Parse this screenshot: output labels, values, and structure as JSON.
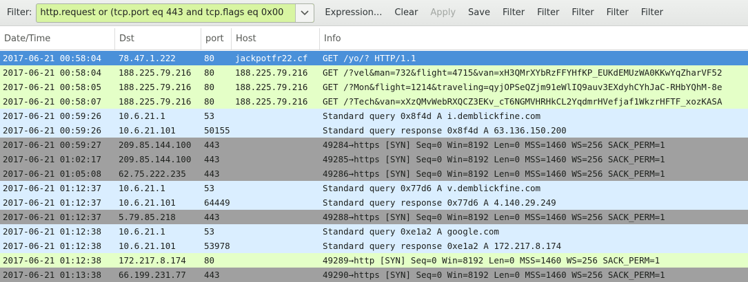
{
  "toolbar": {
    "filter_label": "Filter:",
    "filter_value": "http.request or (tcp.port eq 443 and tcp.flags eq 0x00",
    "filter_bg": "#d8f5a2",
    "expression_label": "Expression...",
    "clear_label": "Clear",
    "apply_label": "Apply",
    "save_label": "Save",
    "filter_buttons": [
      "Filter",
      "Filter",
      "Filter",
      "Filter",
      "Filter"
    ]
  },
  "columns": [
    "Date/Time",
    "Dst",
    "port",
    "Host",
    "Info"
  ],
  "colors": {
    "selected": "#4a90d9",
    "http": "#e4ffc7",
    "udp": "#daeeff",
    "tcp_syn": "#a0a0a0"
  },
  "rows": [
    {
      "datetime": "2017-06-21 00:58:04",
      "dst": "78.47.1.222",
      "port": "80",
      "host": "jackpotfr22.cf",
      "info": "GET /yo/? HTTP/1.1",
      "style": "selected"
    },
    {
      "datetime": "2017-06-21 00:58:04",
      "dst": "188.225.79.216",
      "port": "80",
      "host": "188.225.79.216",
      "info": "GET /?vel&man=732&flight=4715&van=xH3QMrXYbRzFFYHfKP_EUKdEMUzWA0KKwYqZharVF52",
      "style": "http"
    },
    {
      "datetime": "2017-06-21 00:58:05",
      "dst": "188.225.79.216",
      "port": "80",
      "host": "188.225.79.216",
      "info": "GET /?Mon&flight=1214&traveling=qyjOPSeQZjm91eWlIQ9auv3EXdyhCYhJaC-RHbYQhM-8e",
      "style": "http"
    },
    {
      "datetime": "2017-06-21 00:58:07",
      "dst": "188.225.79.216",
      "port": "80",
      "host": "188.225.79.216",
      "info": "GET /?Tech&van=xXzQMvWebRXQCZ3EKv_cT6NGMVHRHkCL2YqdmrHVefjaf1WkzrHFTF_xozKASA",
      "style": "http"
    },
    {
      "datetime": "2017-06-21 00:59:26",
      "dst": "10.6.21.1",
      "port": "53",
      "host": "",
      "info": "Standard query 0x8f4d  A i.demblickfine.com",
      "style": "udp"
    },
    {
      "datetime": "2017-06-21 00:59:26",
      "dst": "10.6.21.101",
      "port": "50155",
      "host": "",
      "info": "Standard query response 0x8f4d  A 63.136.150.200",
      "style": "udp"
    },
    {
      "datetime": "2017-06-21 00:59:27",
      "dst": "209.85.144.100",
      "port": "443",
      "host": "",
      "info": "49284→https [SYN] Seq=0 Win=8192 Len=0 MSS=1460 WS=256 SACK_PERM=1",
      "style": "tcp_syn"
    },
    {
      "datetime": "2017-06-21 01:02:17",
      "dst": "209.85.144.100",
      "port": "443",
      "host": "",
      "info": "49285→https [SYN] Seq=0 Win=8192 Len=0 MSS=1460 WS=256 SACK_PERM=1",
      "style": "tcp_syn"
    },
    {
      "datetime": "2017-06-21 01:05:08",
      "dst": "62.75.222.235",
      "port": "443",
      "host": "",
      "info": "49286→https [SYN] Seq=0 Win=8192 Len=0 MSS=1460 WS=256 SACK_PERM=1",
      "style": "tcp_syn"
    },
    {
      "datetime": "2017-06-21 01:12:37",
      "dst": "10.6.21.1",
      "port": "53",
      "host": "",
      "info": "Standard query 0x77d6  A v.demblickfine.com",
      "style": "udp"
    },
    {
      "datetime": "2017-06-21 01:12:37",
      "dst": "10.6.21.101",
      "port": "64449",
      "host": "",
      "info": "Standard query response 0x77d6  A 4.140.29.249",
      "style": "udp"
    },
    {
      "datetime": "2017-06-21 01:12:37",
      "dst": "5.79.85.218",
      "port": "443",
      "host": "",
      "info": "49288→https [SYN] Seq=0 Win=8192 Len=0 MSS=1460 WS=256 SACK_PERM=1",
      "style": "tcp_syn"
    },
    {
      "datetime": "2017-06-21 01:12:38",
      "dst": "10.6.21.1",
      "port": "53",
      "host": "",
      "info": "Standard query 0xe1a2  A google.com",
      "style": "udp"
    },
    {
      "datetime": "2017-06-21 01:12:38",
      "dst": "10.6.21.101",
      "port": "53978",
      "host": "",
      "info": "Standard query response 0xe1a2  A 172.217.8.174",
      "style": "udp"
    },
    {
      "datetime": "2017-06-21 01:12:38",
      "dst": "172.217.8.174",
      "port": "80",
      "host": "",
      "info": "49289→http [SYN] Seq=0 Win=8192 Len=0 MSS=1460 WS=256 SACK_PERM=1",
      "style": "http"
    },
    {
      "datetime": "2017-06-21 01:13:38",
      "dst": "66.199.231.77",
      "port": "443",
      "host": "",
      "info": "49290→https [SYN] Seq=0 Win=8192 Len=0 MSS=1460 WS=256 SACK_PERM=1",
      "style": "tcp_syn"
    }
  ]
}
